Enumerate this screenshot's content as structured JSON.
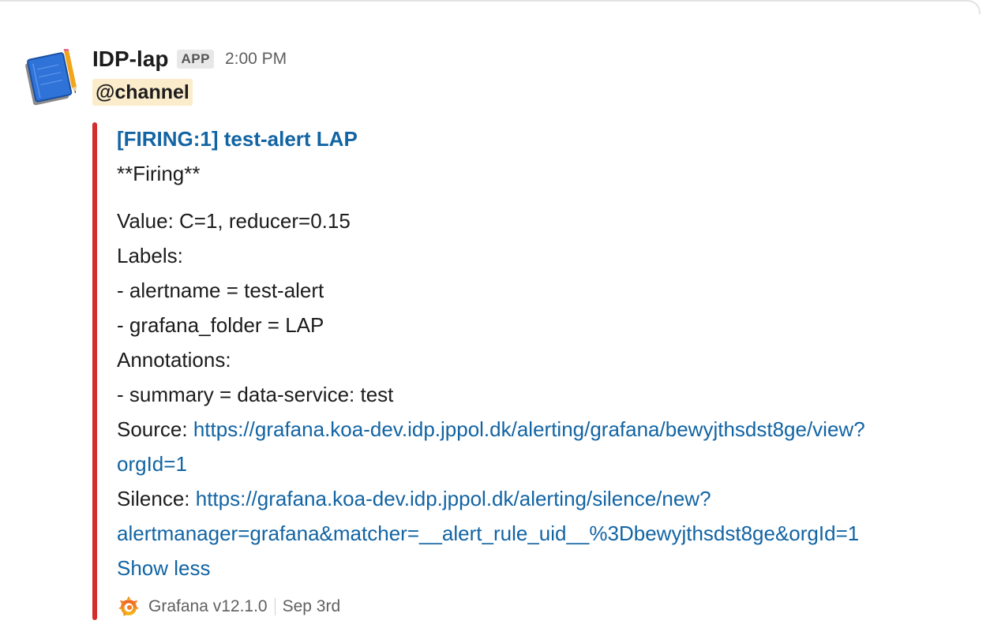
{
  "message": {
    "sender": "IDP-lap",
    "badge": "APP",
    "time": "2:00 PM",
    "mention": "@channel"
  },
  "attachment": {
    "color": "#d42d2d",
    "title": "[FIRING:1] test-alert LAP",
    "status_line": "**Firing**",
    "value_line": "Value: C=1, reducer=0.15",
    "labels_heading": "Labels:",
    "label_alertname": "- alertname = test-alert",
    "label_folder": "- grafana_folder = LAP",
    "annotations_heading": "Annotations:",
    "annotation_summary": "- summary = data-service: test",
    "source_label": "Source:",
    "source_url_part1": "https://grafana.koa-dev.idp.jppol.dk/alerting/grafana/bewyjthsdst8ge/view?",
    "source_url_part2": "orgId=1",
    "silence_label": "Silence:",
    "silence_url_part1": "https://grafana.koa-dev.idp.jppol.dk/alerting/silence/new?",
    "silence_url_part2": "alertmanager=grafana&matcher=__alert_rule_uid__%3Dbewyjthsdst8ge&orgId=1",
    "show_less": "Show less"
  },
  "footer": {
    "icon": "grafana-icon",
    "app_name": "Grafana v12.1.0",
    "date": "Sep 3rd"
  },
  "colors": {
    "link": "#1264a3",
    "mention_bg": "#fbeccb",
    "alert_bar": "#d42d2d"
  }
}
